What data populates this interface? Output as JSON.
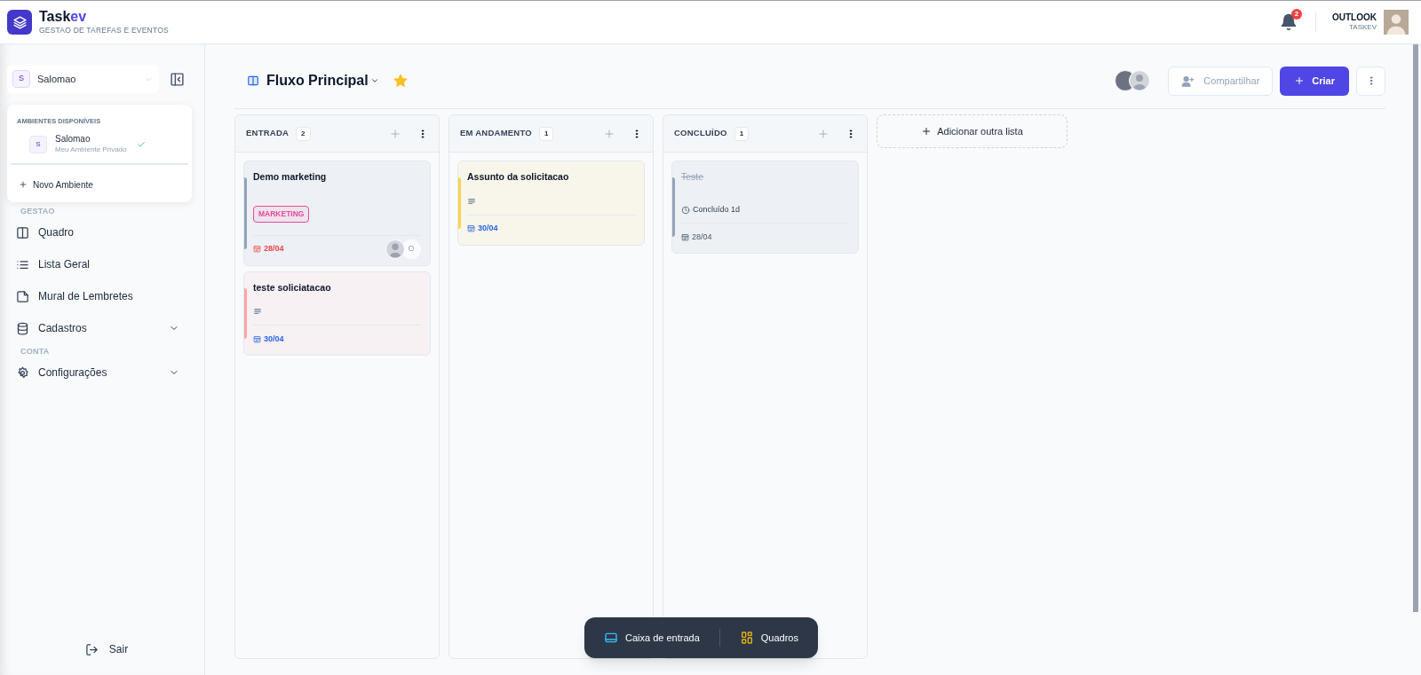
{
  "header": {
    "logo_name": "Task",
    "logo_accent": "ev",
    "subtitle": "GESTAO DE TAREFAS E EVENTOS",
    "notifications": "2",
    "user_name": "OUTLOOK",
    "user_org": "TASKEV"
  },
  "workspace": {
    "initial": "S",
    "name": "Salomao"
  },
  "workspace_menu": {
    "heading": "AMBIENTES DISPONÍVEIS",
    "items": [
      {
        "initial": "S",
        "name": "Salomao",
        "description": "Meu Ambiente Privado",
        "selected": true
      }
    ],
    "new_label": "Novo Ambiente"
  },
  "nav_sections": [
    {
      "heading": "GESTAO",
      "items": [
        {
          "label": "Quadro",
          "kind": "board",
          "expandable": false
        },
        {
          "label": "Lista Geral",
          "kind": "list",
          "expandable": false
        },
        {
          "label": "Mural de Lembretes",
          "kind": "note",
          "expandable": false
        },
        {
          "label": "Cadastros",
          "kind": "database",
          "expandable": true
        }
      ]
    },
    {
      "heading": "CONTA",
      "items": [
        {
          "label": "Configurações",
          "kind": "settings",
          "expandable": true
        }
      ]
    }
  ],
  "logout": "Sair",
  "board": {
    "title": "Fluxo Principal",
    "favorite": true,
    "share": "Compartilhar",
    "create": "Criar",
    "add_list": "Adicionar outra lista",
    "columns": [
      {
        "title": "ENTRADA",
        "count": "2",
        "cards": [
          {
            "title": "Demo marketing",
            "color": "#94a3b8",
            "done": false,
            "tag": {
              "label": "MARKETING",
              "color": "#ec4899"
            },
            "has_description": false,
            "date": "28/04",
            "overdue": true,
            "avatars": [
              {
                "kind": "picture"
              },
              {
                "kind": "initial",
                "initial": "O"
              }
            ]
          },
          {
            "title": "teste soliciatacao",
            "color": "#fca5a5",
            "done": false,
            "has_description": true,
            "date": "30/04",
            "overdue": false
          }
        ]
      },
      {
        "title": "EM ANDAMENTO",
        "count": "1",
        "cards": [
          {
            "title": "Assunto da solicitacao",
            "color": "#fcd34d",
            "done": false,
            "has_description": true,
            "date": "30/04",
            "overdue": false
          }
        ]
      },
      {
        "title": "CONCLUÍDO",
        "count": "1",
        "cards": [
          {
            "title": "Teste",
            "color": "#94a3b8",
            "done": true,
            "has_description": false,
            "completed": "Concluído 1d",
            "date": "28/04",
            "overdue": false
          }
        ]
      }
    ]
  },
  "bottom_nav": [
    {
      "label": "Caixa de entrada",
      "kind": "inbox"
    },
    {
      "label": "Quadros",
      "kind": "boards"
    }
  ]
}
